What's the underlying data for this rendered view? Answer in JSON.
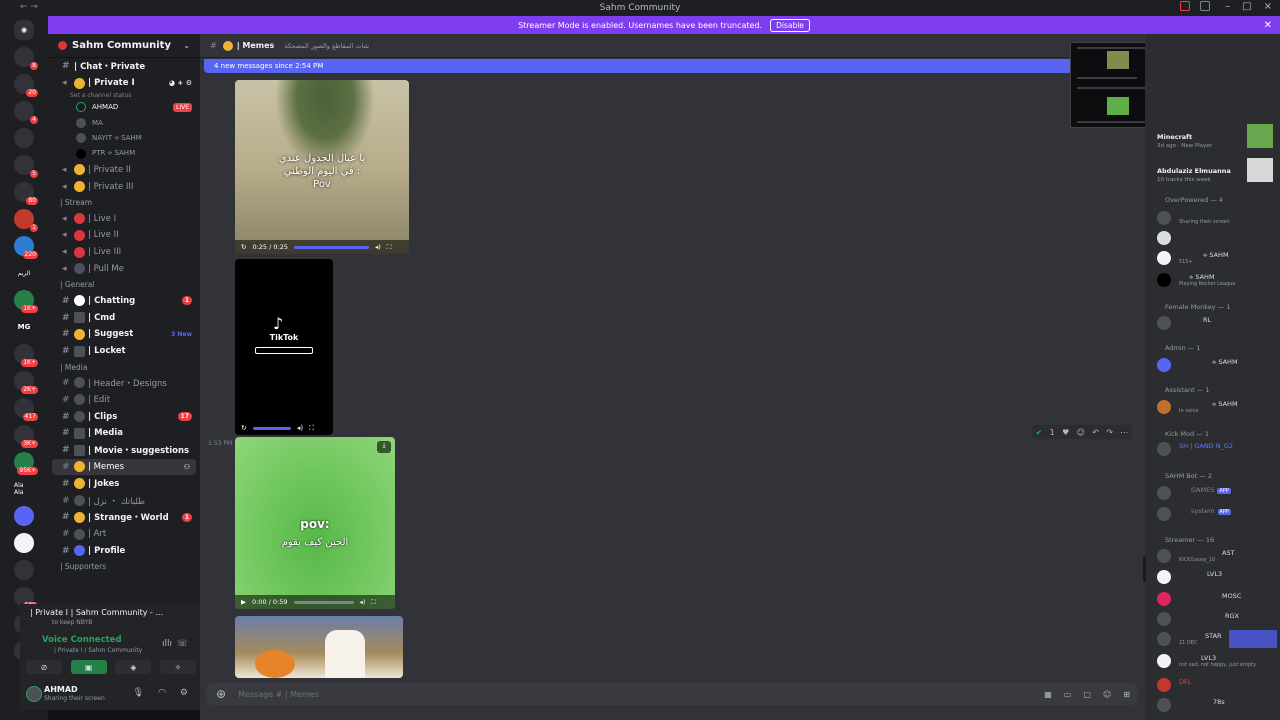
{
  "window": {
    "title": "Sahm Community",
    "streamer_text": "Streamer Mode is enabled. Usernames have been truncated.",
    "disable_label": "Disable"
  },
  "server": {
    "name": "Sahm Community"
  },
  "rail": {
    "badges": [
      "8",
      "20",
      "4",
      "5",
      "80",
      "1",
      "220",
      "1K+",
      "MG",
      "1K+",
      "2K+",
      "417",
      "3K+",
      "95K+",
      "501"
    ],
    "labels": [
      "ﺍﻟﺮﻳﻢ",
      "Ala Ala"
    ]
  },
  "channels": {
    "chat_private": "| Chat・Private",
    "private_i": "| Private I",
    "set_status": "Set a channel status",
    "voice_users": [
      {
        "name": "AHMAD",
        "live": "LIVE"
      },
      {
        "name": "MA"
      },
      {
        "name": "NAYIT ⟡ SAHM"
      },
      {
        "name": "PTR ⟡ SAHM"
      }
    ],
    "private_ii": "| Private II",
    "private_iii": "| Private III",
    "cat_stream": "| Stream",
    "live_i": "| Live I",
    "live_ii": "| Live II",
    "live_iii": "| Live III",
    "pull_me": "| Pull Me",
    "cat_general": "| General",
    "chatting": "| Chatting",
    "chatting_badge": "1",
    "cmd": "| Cmd",
    "suggest": "| Suggest",
    "suggest_new": "3 New",
    "locket": "| Locket",
    "cat_media": "| Media",
    "header_designs": "| Header・Designs",
    "edit": "| Edit",
    "clips": "| Clips",
    "clips_badge": "17",
    "media": "| Media",
    "movie": "| Movie・suggestions",
    "memes": "| Memes",
    "jokes": "| Jokes",
    "arabic": "| ﻃﻠﺒﺎﺗﻚ ・ ﻧﺰﻝ",
    "strange": "| Strange・World",
    "strange_badge": "1",
    "art": "| Art",
    "profile": "| Profile",
    "cat_supporters": "| Supporters"
  },
  "voice_panel": {
    "line1": "| Private I | Sahm Community - ...",
    "sub": "to keep NBYB",
    "connected": "Voice Connected",
    "channel": "| Private I / Sahm Community"
  },
  "user_panel": {
    "name": "AHMAD",
    "status": "Sharing their screen"
  },
  "chat": {
    "channel_name": "| Memes",
    "topic": "ﺷﺎﺕ ﺍﻟﻤﻘﺎﻃﻊ ﻭﺍﻟﺼﻮﺭ ﺍﻟﻤﻀﺤﻜﺔ",
    "new_messages": "4 new messages since 2:54 PM",
    "video1_caption": "ﻳﺎ ﻋﻴﺎﻝ ﺍﻟﺠﺪﻭﻝ ﻋﻨﺪﻱ\nﻓﻲ ﺍﻟﻴﻮﻡ ﺍﻟﻮﻃﻨﻲ :\nPov",
    "video1_time": "0:25 / 0:25",
    "tiktok": "TikTok",
    "timestamp": "1:53 PM",
    "video3_caption1": "pov:",
    "video3_caption2": "ﺍﻟﺤﻴﻦ ﻛﻴﻒ ﻳﻘﻮﻡ",
    "video3_time": "0:00 / 0:59",
    "reaction_count": "1",
    "composer_placeholder": "Message # | Memes"
  },
  "members": {
    "activity1_name": "Minecraft",
    "activity1_sub": "3d ago · New Player",
    "activity2_name": "Abdulaziz Elmuanna",
    "activity2_sub": "10 tracks this week",
    "groups": [
      {
        "label": "OverPowered — 4",
        "rows": [
          {
            "name": "",
            "act": "Sharing their screen"
          },
          {
            "name": "",
            "act": ""
          },
          {
            "name": "⟡ SAHM",
            "act": "515+"
          },
          {
            "name": "⟡ SAHM",
            "act": "Playing Rocket League"
          }
        ]
      },
      {
        "label": "Female Monkey — 1",
        "rows": [
          {
            "name": "RL",
            "act": ""
          }
        ]
      },
      {
        "label": "Admin — 1",
        "rows": [
          {
            "name": "⟡ SAHM",
            "act": ""
          }
        ]
      },
      {
        "label": "Assistant — 1",
        "rows": [
          {
            "name": "⟡ SAHM",
            "act": "In voice"
          }
        ]
      },
      {
        "label": "Kick Mod — 1",
        "rows": [
          {
            "name": "SH | GAND N_G2",
            "act": ""
          }
        ]
      },
      {
        "label": "SAHM Bot — 2",
        "rows": [
          {
            "name": "GAMES",
            "act": "",
            "app": "APP"
          },
          {
            "name": "system",
            "act": "",
            "app": "APP"
          }
        ]
      },
      {
        "label": "Streamer — 16",
        "rows": [
          {
            "name": "AST",
            "act": "KICK/Leosy_10"
          },
          {
            "name": "LVL3",
            "act": ""
          },
          {
            "name": "MOSC",
            "act": ""
          },
          {
            "name": "RGX",
            "act": ""
          },
          {
            "name": "STAR",
            "act": "21 DEC"
          },
          {
            "name": "LVL3",
            "act": "not sad, not happy, just empty."
          },
          {
            "name": "DFL",
            "act": ""
          },
          {
            "name": "78s",
            "act": ""
          }
        ]
      }
    ]
  },
  "colors": {
    "accent": "#5865f2",
    "streamer": "#7e3ef0",
    "online": "#23a55a",
    "danger": "#f23f43"
  }
}
